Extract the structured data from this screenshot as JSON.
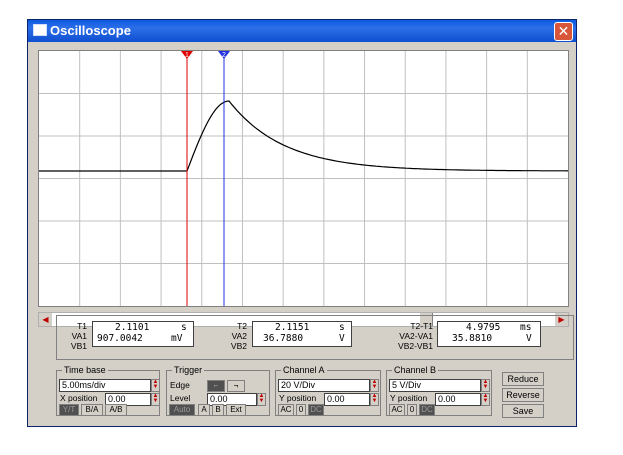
{
  "window": {
    "title": "Oscilloscope",
    "close_glyph": "✕"
  },
  "readout": {
    "t1_label": "T1",
    "t1_value": "2.1101",
    "t1_unit": "s",
    "va1_label": "VA1",
    "va1_value": "907.0042",
    "va1_unit": "mV",
    "vb1_label": "VB1",
    "t2_label": "T2",
    "t2_value": "2.1151",
    "t2_unit": "s",
    "va2_label": "VA2",
    "va2_value": "36.7880",
    "va2_unit": "V",
    "vb2_label": "VB2",
    "dt_label": "T2-T1",
    "dt_value": "4.9795",
    "dt_unit": "ms",
    "dva_label": "VA2-VA1",
    "dva_value": "35.8810",
    "dva_unit": "V",
    "dvb_label": "VB2-VB1"
  },
  "timebase": {
    "title": "Time base",
    "value": "5.00ms/div",
    "xpos_label": "X position",
    "xpos_value": "0.00",
    "buttons": [
      "Y/T",
      "B/A",
      "A/B"
    ]
  },
  "trigger": {
    "title": "Trigger",
    "edge_label": "Edge",
    "level_label": "Level",
    "level_value": "0.00",
    "buttons": [
      "Auto",
      "A",
      "B",
      "Ext"
    ]
  },
  "channel_a": {
    "title": "Channel A",
    "value": "20 V/Div",
    "ypos_label": "Y position",
    "ypos_value": "0.00",
    "coupling": [
      "AC",
      "0",
      "DC"
    ]
  },
  "channel_b": {
    "title": "Channel B",
    "value": "5 V/Div",
    "ypos_label": "Y position",
    "ypos_value": "0.00",
    "coupling": [
      "AC",
      "0",
      "DC"
    ]
  },
  "actions": {
    "reduce": "Reduce",
    "reverse": "Reverse",
    "save": "Save"
  },
  "cursors": {
    "c1_label": "1",
    "c2_label": "2",
    "c1_color": "#e00000",
    "c2_color": "#2030e0"
  },
  "colors": {
    "trace": "#000000",
    "grid": "#c0c0c0",
    "titlebar": "#0a5adf"
  }
}
